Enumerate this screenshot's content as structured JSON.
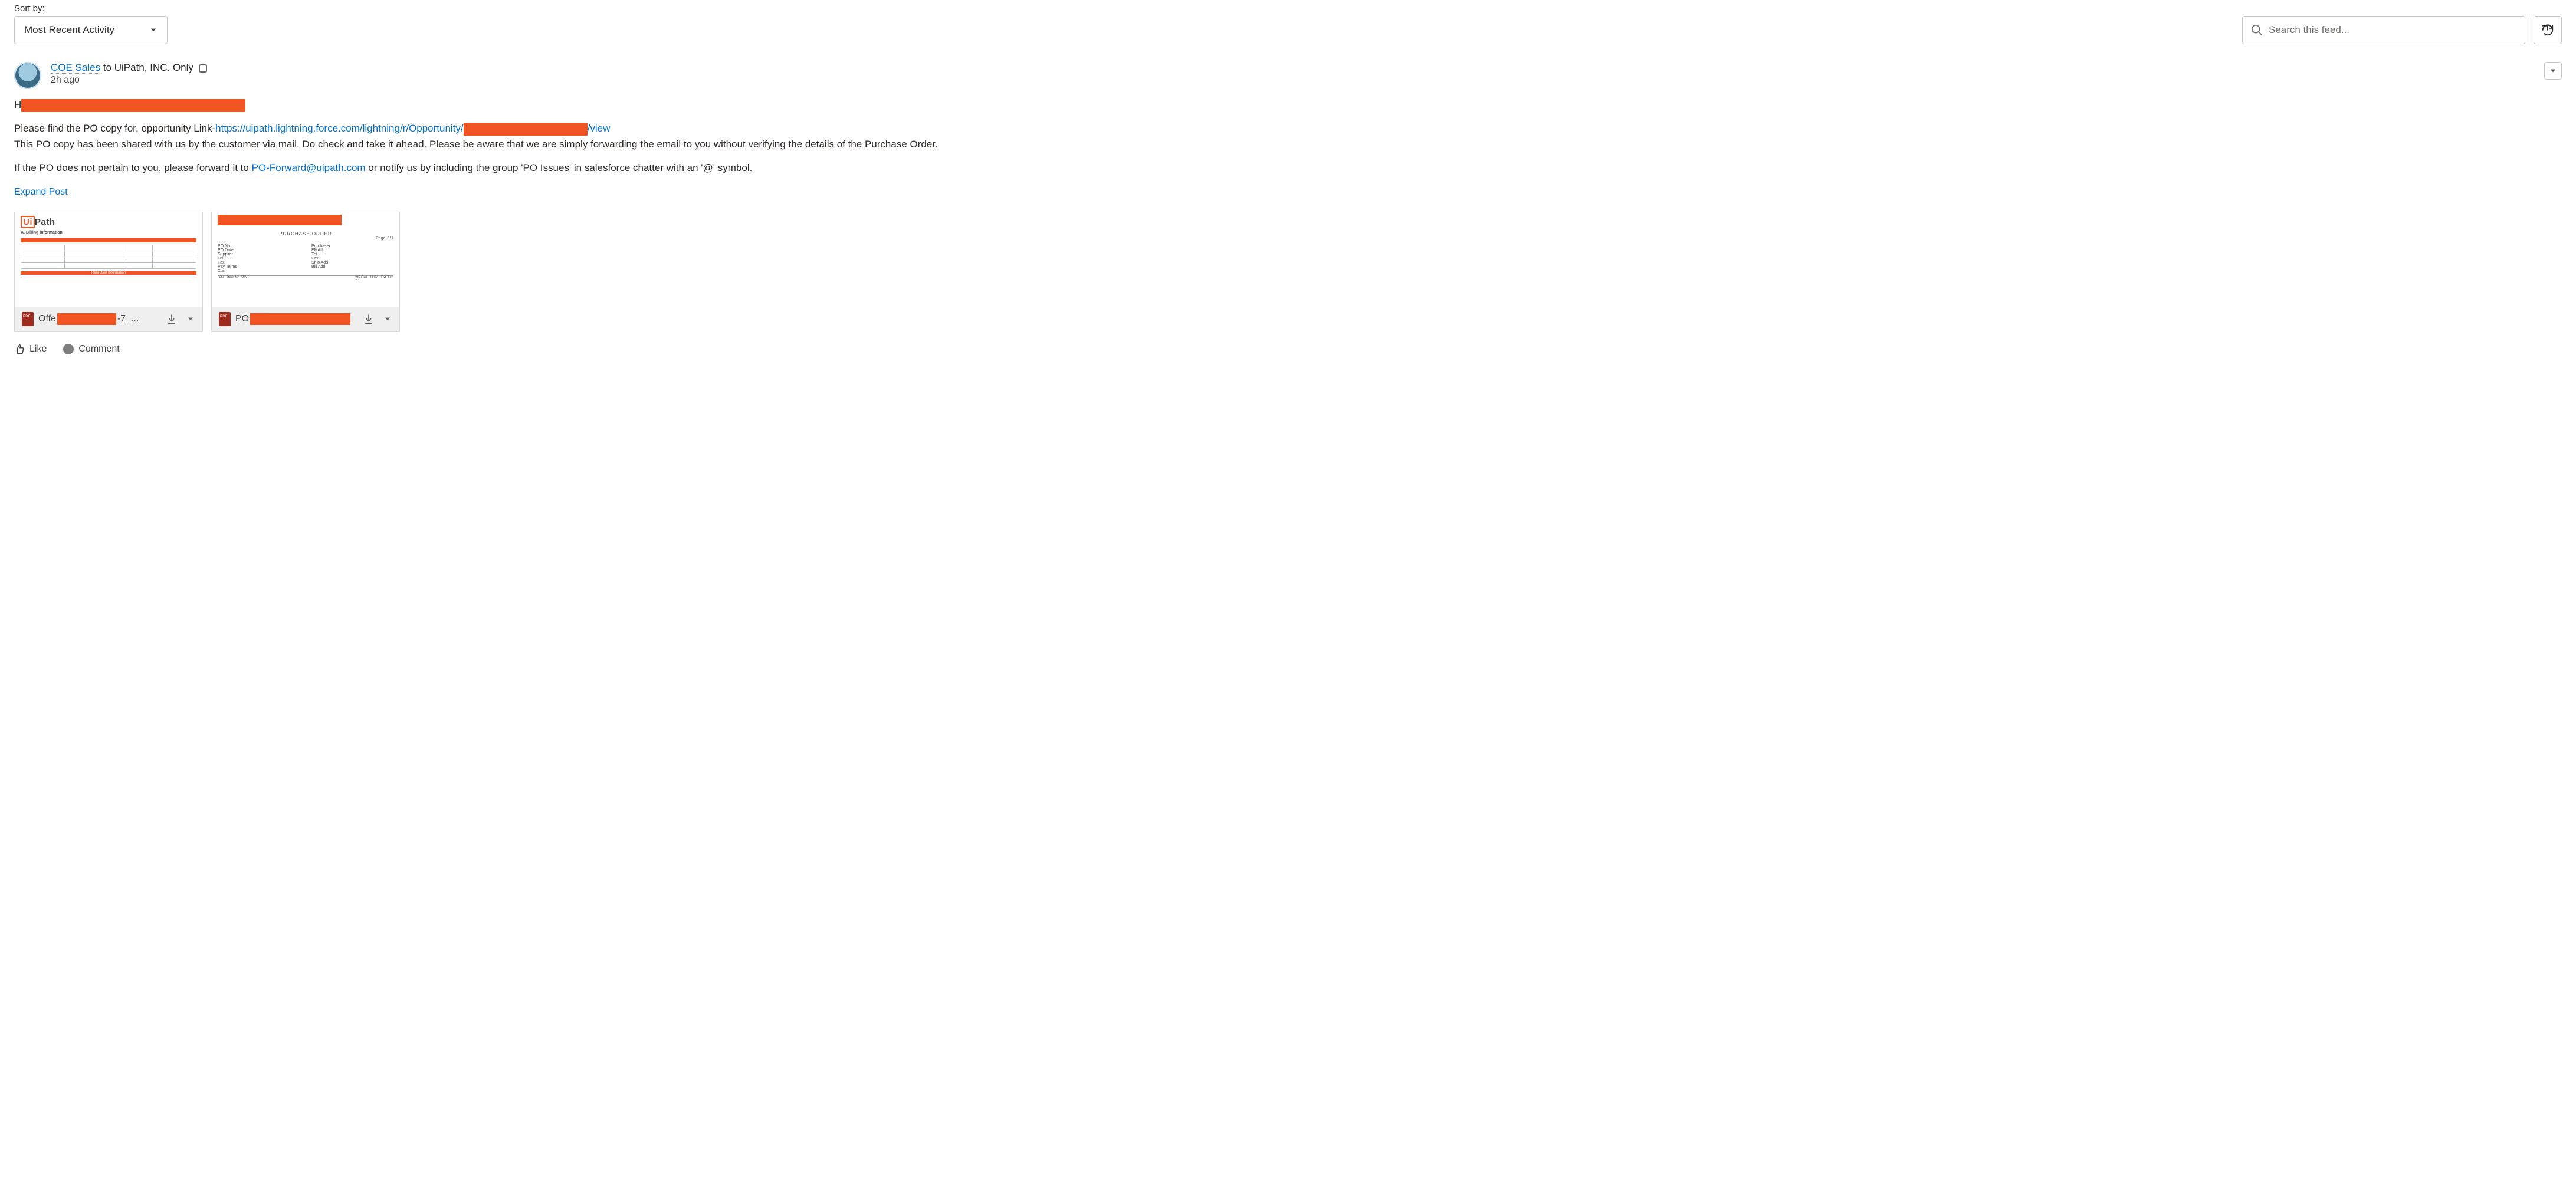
{
  "toolbar": {
    "sort_label": "Sort by:",
    "sort_value": "Most Recent Activity",
    "search_placeholder": "Search this feed..."
  },
  "post": {
    "author": "COE Sales",
    "audience_prefix": "to",
    "audience": "UiPath, INC. Only",
    "timestamp": "2h ago",
    "greeting": "H",
    "body_line1_prefix": "Please find the PO copy for, opportunity Link-",
    "opp_link_a": "https://uipath.lightning.force.com/lightning/r/Opportunity/",
    "opp_link_b": "/view",
    "body_line2": "This PO copy has been shared with us by the customer via mail. Do check and take it ahead. Please be aware that we are simply forwarding the email to you without verifying the details of the Purchase Order.",
    "body_line3_a": "If the PO does not pertain to you, please forward it to ",
    "forward_email": "PO-Forward@uipath.com",
    "body_line3_b": " or notify us by including the group 'PO Issues' in salesforce chatter with an '@' symbol.",
    "expand_label": "Expand Post"
  },
  "attachments": [
    {
      "name_prefix": "Offe",
      "name_suffix": "-7_...",
      "preview_kind": "quote",
      "logo_text_a": "Ui",
      "logo_text_b": "Path",
      "section_label": "A. Billing Information",
      "bar2_label": "Real User Information"
    },
    {
      "name_prefix": "PO",
      "name_suffix": "",
      "preview_kind": "po",
      "po_title": "PURCHASE ORDER",
      "page_label": "Page: 1/1"
    }
  ],
  "actions": {
    "like": "Like",
    "comment": "Comment"
  }
}
